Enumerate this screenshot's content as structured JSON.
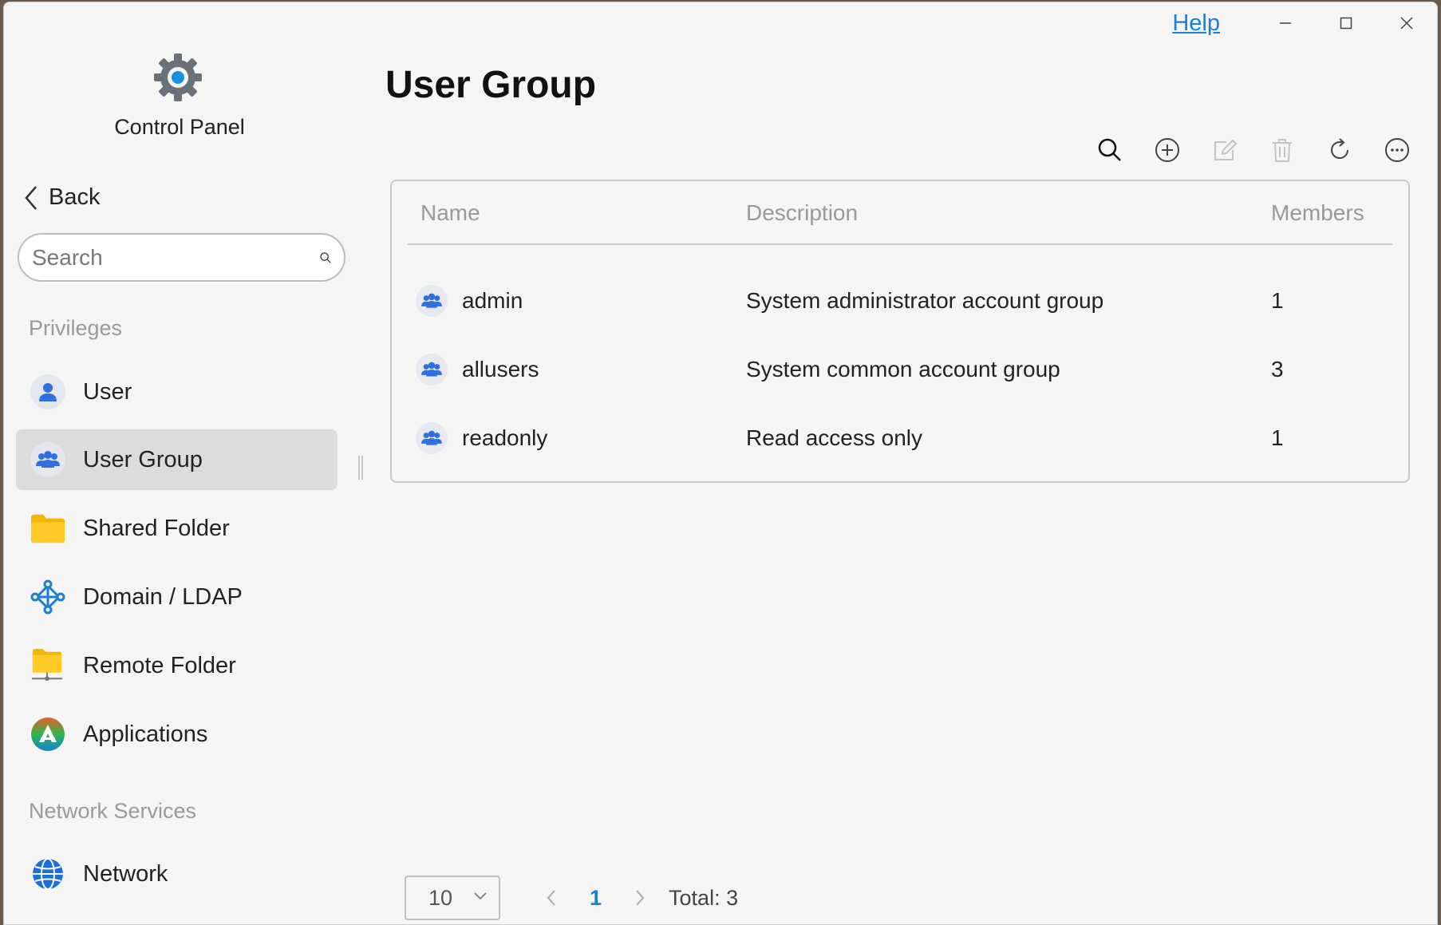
{
  "window": {
    "help_label": "Help"
  },
  "sidebar": {
    "app_name": "Control Panel",
    "back_label": "Back",
    "search_placeholder": "Search",
    "section_privileges": "Privileges",
    "section_network": "Network Services",
    "items": [
      {
        "label": "User",
        "icon": "user-icon"
      },
      {
        "label": "User Group",
        "icon": "user-group-icon",
        "active": true
      },
      {
        "label": "Shared Folder",
        "icon": "folder-icon"
      },
      {
        "label": "Domain / LDAP",
        "icon": "domain-icon"
      },
      {
        "label": "Remote Folder",
        "icon": "remote-folder-icon"
      },
      {
        "label": "Applications",
        "icon": "applications-icon"
      },
      {
        "label": "Network",
        "icon": "network-globe-icon"
      }
    ]
  },
  "main": {
    "title": "User Group",
    "columns": {
      "name": "Name",
      "description": "Description",
      "members": "Members"
    },
    "rows": [
      {
        "name": "admin",
        "description": "System administrator account group",
        "members": "1"
      },
      {
        "name": "allusers",
        "description": "System common account group",
        "members": "3"
      },
      {
        "name": "readonly",
        "description": "Read access only",
        "members": "1"
      }
    ],
    "pager": {
      "page_size": "10",
      "current_page": "1",
      "total": "Total: 3"
    }
  },
  "colors": {
    "accent": "#1a7fd6",
    "active_bg": "#dcdcdc"
  }
}
